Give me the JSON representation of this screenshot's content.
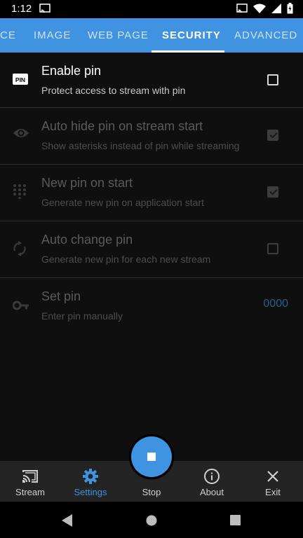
{
  "status_bar": {
    "time": "1:12"
  },
  "tabs": [
    {
      "label": "CE",
      "active": false
    },
    {
      "label": "IMAGE",
      "active": false
    },
    {
      "label": "WEB PAGE",
      "active": false
    },
    {
      "label": "SECURITY",
      "active": true
    },
    {
      "label": "ADVANCED",
      "active": false
    }
  ],
  "settings": [
    {
      "icon": "pin-icon",
      "icon_text": "PIN",
      "title": "Enable pin",
      "subtitle": "Protect access to stream with pin",
      "control": "checkbox",
      "checked": false,
      "enabled": true
    },
    {
      "icon": "eye-icon",
      "title": "Auto hide pin on stream start",
      "subtitle": "Show asterisks instead of pin while streaming",
      "control": "checkbox",
      "checked": true,
      "enabled": false
    },
    {
      "icon": "dialpad-icon",
      "title": "New pin on start",
      "subtitle": "Generate new pin on application start",
      "control": "checkbox",
      "checked": true,
      "enabled": false
    },
    {
      "icon": "refresh-icon",
      "title": "Auto change pin",
      "subtitle": "Generate new pin for each new stream",
      "control": "checkbox",
      "checked": false,
      "enabled": false
    },
    {
      "icon": "key-icon",
      "title": "Set pin",
      "subtitle": "Enter pin manually",
      "control": "value",
      "value": "0000",
      "enabled": false
    }
  ],
  "bottom_nav": [
    {
      "icon": "cast-icon",
      "label": "Stream",
      "active": false
    },
    {
      "icon": "gear-icon",
      "label": "Settings",
      "active": true
    },
    {
      "icon": "stop-icon",
      "label": "Stop",
      "active": false
    },
    {
      "icon": "info-icon",
      "label": "About",
      "active": false
    },
    {
      "icon": "close-icon",
      "label": "Exit",
      "active": false
    }
  ],
  "colors": {
    "accent": "#3f93e0",
    "background": "#0f0f0f",
    "nav_background": "#242424"
  }
}
